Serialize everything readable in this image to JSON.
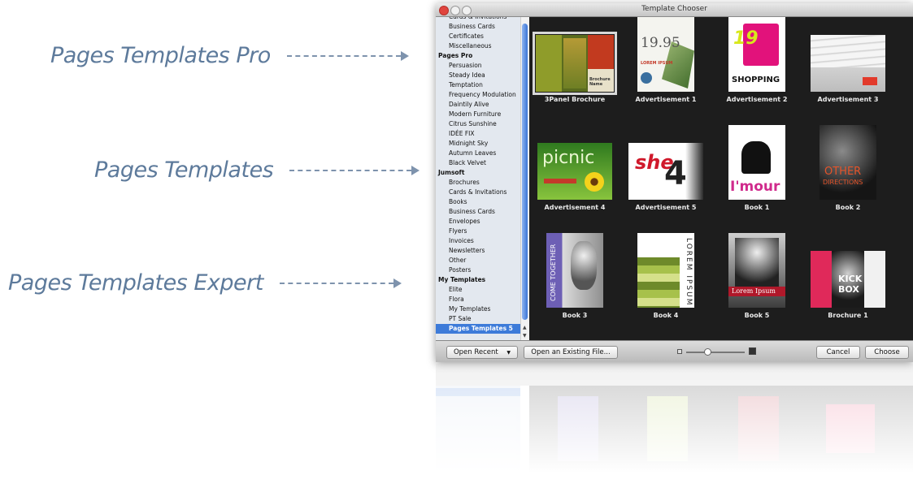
{
  "callouts": [
    {
      "label": "Pages Templates Pro"
    },
    {
      "label": "Pages Templates"
    },
    {
      "label": "Pages Templates Expert"
    }
  ],
  "window": {
    "title": "Template Chooser"
  },
  "sidebar": {
    "items": [
      {
        "label": "Cards & Invitations",
        "group": false
      },
      {
        "label": "Business Cards",
        "group": false
      },
      {
        "label": "Certificates",
        "group": false
      },
      {
        "label": "Miscellaneous",
        "group": false
      },
      {
        "label": "Pages Pro",
        "group": true
      },
      {
        "label": "Persuasion",
        "group": false
      },
      {
        "label": "Steady Idea",
        "group": false
      },
      {
        "label": "Temptation",
        "group": false
      },
      {
        "label": "Frequency Modulation",
        "group": false
      },
      {
        "label": "Daintily Alive",
        "group": false
      },
      {
        "label": "Modern Furniture",
        "group": false
      },
      {
        "label": "Citrus Sunshine",
        "group": false
      },
      {
        "label": "IDÉE FIX",
        "group": false
      },
      {
        "label": "Midnight Sky",
        "group": false
      },
      {
        "label": "Autumn Leaves",
        "group": false
      },
      {
        "label": "Black Velvet",
        "group": false
      },
      {
        "label": "Jumsoft",
        "group": true
      },
      {
        "label": "Brochures",
        "group": false
      },
      {
        "label": "Cards & Invitations",
        "group": false
      },
      {
        "label": "Books",
        "group": false
      },
      {
        "label": "Business Cards",
        "group": false
      },
      {
        "label": "Envelopes",
        "group": false
      },
      {
        "label": "Flyers",
        "group": false
      },
      {
        "label": "Invoices",
        "group": false
      },
      {
        "label": "Newsletters",
        "group": false
      },
      {
        "label": "Other",
        "group": false
      },
      {
        "label": "Posters",
        "group": false
      },
      {
        "label": "My Templates",
        "group": true
      },
      {
        "label": "Elite",
        "group": false
      },
      {
        "label": "Flora",
        "group": false
      },
      {
        "label": "My Templates",
        "group": false
      },
      {
        "label": "PT Sale",
        "group": false
      },
      {
        "label": "Pages Templates 5",
        "group": false,
        "selected": true
      }
    ]
  },
  "templates": [
    {
      "name": "3Panel Brochure",
      "selected": true
    },
    {
      "name": "Advertisement 1"
    },
    {
      "name": "Advertisement 2"
    },
    {
      "name": "Advertisement 3"
    },
    {
      "name": "Advertisement 4"
    },
    {
      "name": "Advertisement 5"
    },
    {
      "name": "Book 1"
    },
    {
      "name": "Book 2"
    },
    {
      "name": "Book 3"
    },
    {
      "name": "Book 4"
    },
    {
      "name": "Book 5"
    },
    {
      "name": "Brochure 1"
    }
  ],
  "thumb_text": {
    "adv1_price": "19.95",
    "adv1_word": "LOREM IPSUM",
    "adv2_price": "19",
    "adv2_word": "SHOPPING",
    "adv4_word": "picnic",
    "adv5_word": "she",
    "adv5_num": "4",
    "book1_word": "I'mour",
    "book2_word1": "OTHER",
    "book2_word2": "DIRECTIONS",
    "book3_word": "COME TOGETHER",
    "book4_word": "LOREM IPSUM",
    "book5_word": "Lorem Ipsum",
    "brochure1_word": "KICK BOX",
    "brochure_panel_word": "Brochure Name"
  },
  "bottombar": {
    "open_recent": "Open Recent",
    "open_existing": "Open an Existing File...",
    "cancel": "Cancel",
    "choose": "Choose"
  }
}
